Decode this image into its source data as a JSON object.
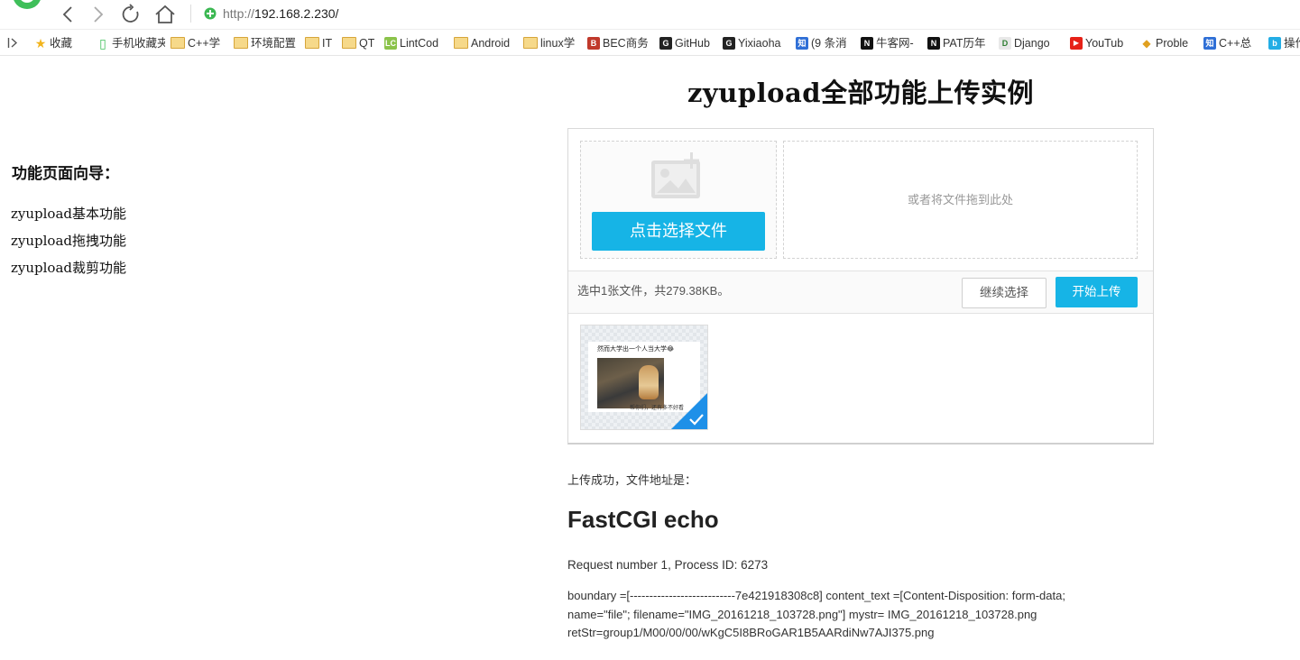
{
  "browser": {
    "address_proto": "http://",
    "address_host": "192.168.2.230/",
    "bookmarks": [
      {
        "label": "收藏",
        "icon": "star-icon"
      },
      {
        "label": "手机收藏夹",
        "icon": "phone-icon"
      },
      {
        "label": "C++学",
        "icon": "folder-icon"
      },
      {
        "label": "环境配置",
        "icon": "folder-icon"
      },
      {
        "label": "IT",
        "icon": "folder-icon"
      },
      {
        "label": "QT",
        "icon": "folder-icon"
      },
      {
        "label": "LintCod",
        "icon": "lintcode-icon"
      },
      {
        "label": "Android",
        "icon": "folder-icon"
      },
      {
        "label": "linux学",
        "icon": "folder-icon"
      },
      {
        "label": "BEC商务",
        "icon": "bec-icon"
      },
      {
        "label": "GitHub",
        "icon": "github-icon"
      },
      {
        "label": "Yixiaoha",
        "icon": "github-icon"
      },
      {
        "label": "(9 条消",
        "icon": "zhihu-icon"
      },
      {
        "label": "牛客网-",
        "icon": "nowcoder-icon"
      },
      {
        "label": "PAT历年",
        "icon": "nowcoder-icon"
      },
      {
        "label": "Django",
        "icon": "django-icon"
      },
      {
        "label": "YouTub",
        "icon": "youtube-icon"
      },
      {
        "label": "Proble",
        "icon": "problem-icon"
      },
      {
        "label": "C++总",
        "icon": "zhihu-icon"
      },
      {
        "label": "操作",
        "icon": "bilibili-icon"
      }
    ],
    "colors": {
      "accent": "#16b4e6"
    }
  },
  "guide": {
    "title": "功能页面向导：",
    "links": [
      "zyupload基本功能",
      "zyupload拖拽功能",
      "zyupload裁剪功能"
    ]
  },
  "page": {
    "title": "zyupload全部功能上传实例"
  },
  "uploader": {
    "select_label": "点击选择文件",
    "drop_hint": "或者将文件拖到此处",
    "status_text": "选中1张文件，共279.38KB。",
    "continue_label": "继续选择",
    "upload_label": "开始上传",
    "thumb_caption": "然而大学出一个人当大学😂",
    "thumb_footer": "帮你们，还有多不好看"
  },
  "result": {
    "label": "上传成功，文件地址是：",
    "echo_title": "FastCGI echo",
    "request_info": "Request number 1, Process ID: 6273",
    "echo_lines": [
      "boundary =[---------------------------7e421918308c8] content_text =[Content-Disposition: form-data;",
      "name=\"file\"; filename=\"IMG_20161218_103728.png\"] mystr= IMG_20161218_103728.png",
      "retStr=group1/M00/00/00/wKgC5I8BRoGAR1B5AARdiNw7AJI375.png"
    ]
  }
}
